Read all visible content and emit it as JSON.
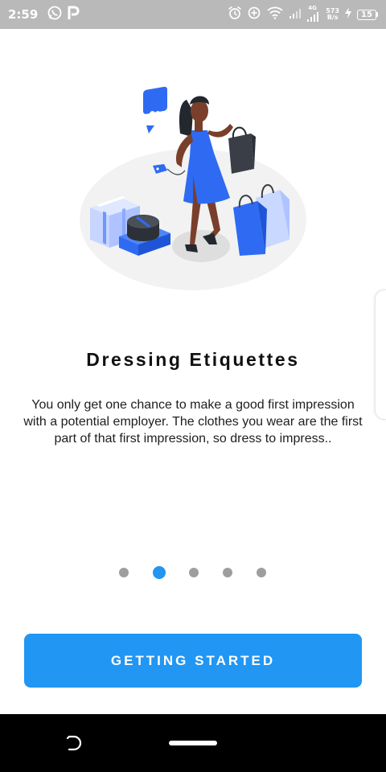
{
  "status_bar": {
    "time": "2:59",
    "left_icons": [
      "whatsapp-icon",
      "p-app-icon"
    ],
    "right_icons": [
      "alarm-icon",
      "data-saver-icon",
      "wifi-icon",
      "signal-icon",
      "signal-4g-icon",
      "charging-icon"
    ],
    "network_type": "4G",
    "net_speed_value": "573",
    "net_speed_unit": "B/s",
    "battery_level": "15"
  },
  "onboarding": {
    "illustration": "woman-shopping-illustration",
    "title": "Dressing Etiquettes",
    "description": "You only get one chance to make a good first impression with a potential employer. The clothes you wear are the first part of that first impression, so dress to impress..",
    "page_indicator": {
      "total": 5,
      "active_index": 1
    },
    "cta_label": "GETTING STARTED"
  },
  "colors": {
    "accent": "#2196f3",
    "inactive_dot": "#9e9e9e",
    "status_bar": "#b9b9b9",
    "nav_bar": "#000000"
  },
  "nav_bar": {
    "icons": [
      "back-gesture-icon",
      "home-pill-icon"
    ]
  }
}
